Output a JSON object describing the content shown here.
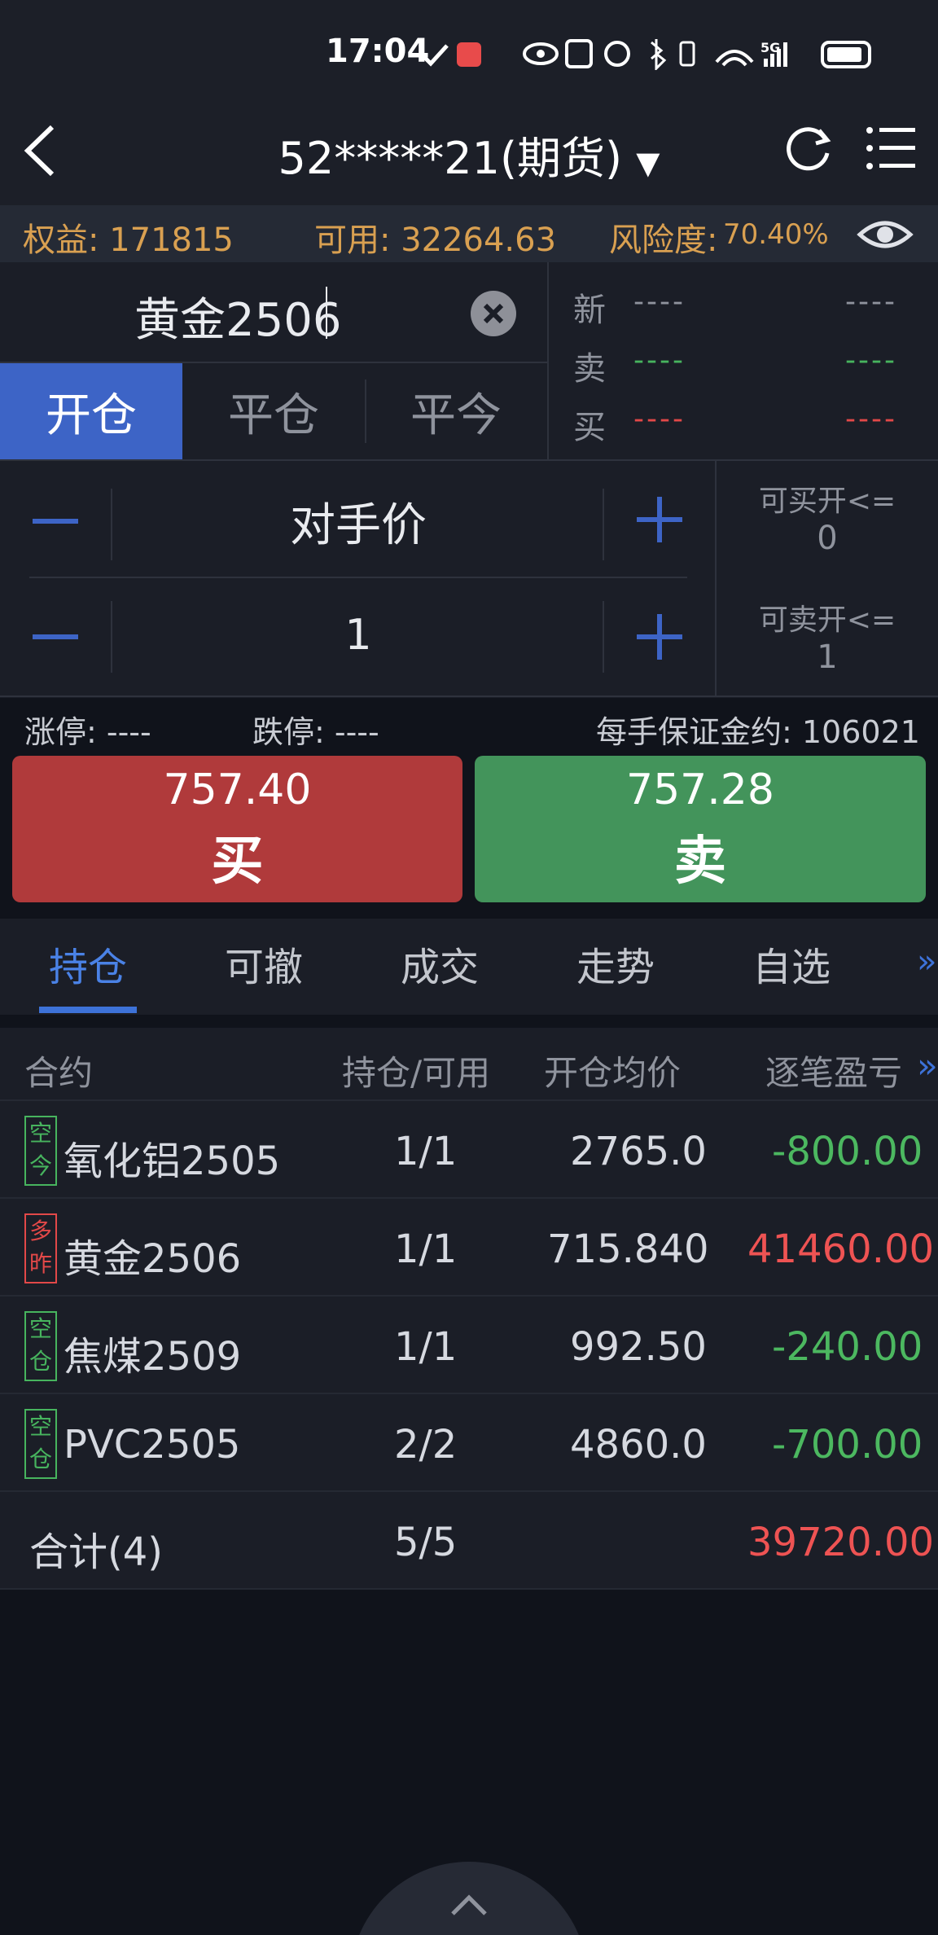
{
  "status_bar": {
    "time": "17:04",
    "network": "5G"
  },
  "header": {
    "account": "52*****21(期货)"
  },
  "info_bar": {
    "equity": "权益: 171815",
    "available": "可用: 32264.63",
    "risk_label": "风险度:",
    "risk_value": "70.40%"
  },
  "order": {
    "symbol": "黄金2506",
    "tabs": {
      "open": "开仓",
      "close": "平仓",
      "close_today": "平今"
    },
    "quote": {
      "latest_label": "新",
      "latest_val1": "----",
      "latest_val2": "----",
      "ask_label": "卖",
      "ask_val1": "----",
      "ask_val2": "----",
      "bid_label": "买",
      "bid_val1": "----",
      "bid_val2": "----"
    },
    "price_mode": "对手价",
    "quantity": "1",
    "can_buy_label": "可买开<=",
    "can_buy_value": "0",
    "can_sell_label": "可卖开<=",
    "can_sell_value": "1"
  },
  "limits": {
    "limit_up": "涨停: ----",
    "limit_down": "跌停: ----",
    "margin": "每手保证金约: 106021"
  },
  "trade_buttons": {
    "buy_price": "757.40",
    "buy_label": "买",
    "sell_price": "757.28",
    "sell_label": "卖"
  },
  "bottom_tabs": [
    "持仓",
    "可撤",
    "成交",
    "走势",
    "自选"
  ],
  "positions": {
    "headers": {
      "contract": "合约",
      "position": "持仓/可用",
      "avg_price": "开仓均价",
      "pnl": "逐笔盈亏"
    },
    "rows": [
      {
        "tag": [
          "空",
          "今"
        ],
        "tag_color": "green",
        "contract": "氧化铝2505",
        "position": "1/1",
        "avg_price": "2765.0",
        "pnl": "-800.00",
        "pnl_sign": "neg"
      },
      {
        "tag": [
          "多",
          "昨"
        ],
        "tag_color": "red",
        "contract": "黄金2506",
        "position": "1/1",
        "avg_price": "715.840",
        "pnl": "41460.00",
        "pnl_sign": "pos"
      },
      {
        "tag": [
          "空",
          "仓"
        ],
        "tag_color": "green",
        "contract": "焦煤2509",
        "position": "1/1",
        "avg_price": "992.50",
        "pnl": "-240.00",
        "pnl_sign": "neg"
      },
      {
        "tag": [
          "空",
          "仓"
        ],
        "tag_color": "green",
        "contract": "PVC2505",
        "position": "2/2",
        "avg_price": "4860.0",
        "pnl": "-700.00",
        "pnl_sign": "neg"
      }
    ],
    "total": {
      "label": "合计(4)",
      "position": "5/5",
      "pnl": "39720.00"
    }
  },
  "colors": {
    "accent": "#3d64c6",
    "buy": "#b03a3b",
    "sell": "#43945b",
    "gold_text": "#d9a051",
    "profit": "#ee5353",
    "loss": "#4cb860"
  },
  "icons": [
    "back-icon",
    "refresh-icon",
    "menu-icon",
    "eye-icon",
    "clear-icon",
    "expand-up-icon"
  ]
}
